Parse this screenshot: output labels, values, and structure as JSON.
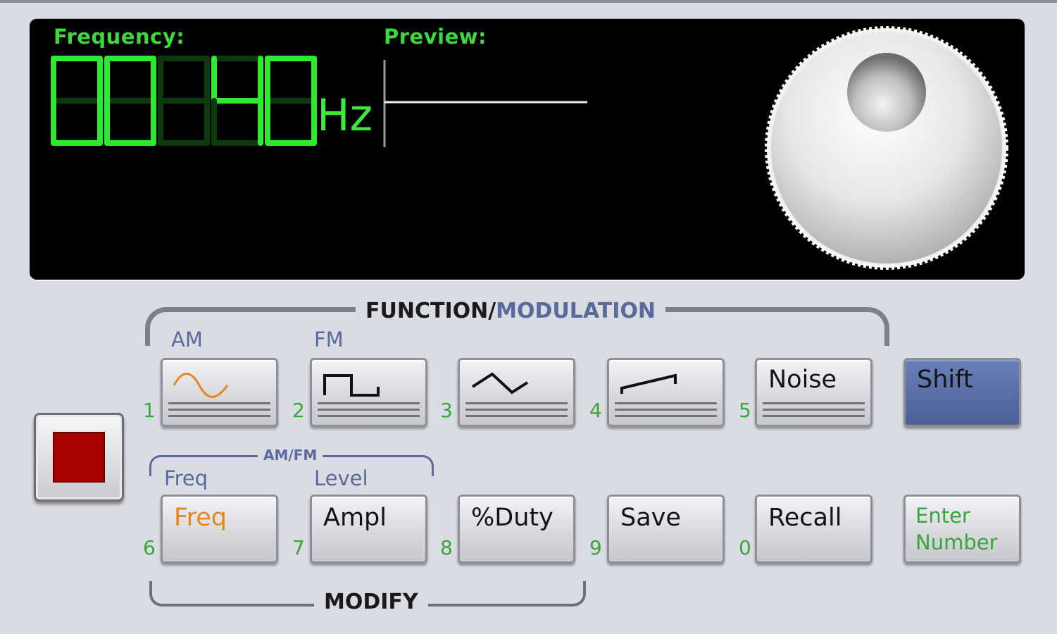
{
  "display": {
    "frequency_label": "Frequency:",
    "preview_label": "Preview:",
    "digits": [
      "0",
      "0",
      " ",
      "4",
      "0",
      " "
    ],
    "unit": "Hz",
    "digit_color": "#30e830",
    "digit_dim_color": "#0d3a0d"
  },
  "brackets": {
    "function": "FUNCTION/",
    "modulation": "MODULATION",
    "amfm": "AM/FM",
    "modify": "MODIFY"
  },
  "shift_labels": {
    "am": "AM",
    "fm": "FM",
    "freq": "Freq",
    "level": "Level"
  },
  "buttons": {
    "sine": {
      "icon": "sine-wave-icon",
      "number": "1"
    },
    "square": {
      "icon": "square-wave-icon",
      "number": "2"
    },
    "triangle": {
      "icon": "triangle-wave-icon",
      "number": "3"
    },
    "ramp": {
      "icon": "ramp-wave-icon",
      "number": "4"
    },
    "noise": {
      "label": "Noise",
      "number": "5"
    },
    "shift": {
      "label": "Shift"
    },
    "freq": {
      "label": "Freq",
      "number": "6"
    },
    "ampl": {
      "label": "Ampl",
      "number": "7"
    },
    "duty": {
      "label": "%Duty",
      "number": "8"
    },
    "save": {
      "label": "Save",
      "number": "9"
    },
    "recall": {
      "label": "Recall",
      "number": "0"
    },
    "enter": {
      "line1": "Enter",
      "line2": "Number"
    }
  },
  "colors": {
    "accent_orange": "#e8861a",
    "shift_blue": "#56699f",
    "number_green": "#3aa53a",
    "stop_red": "#a80000"
  }
}
